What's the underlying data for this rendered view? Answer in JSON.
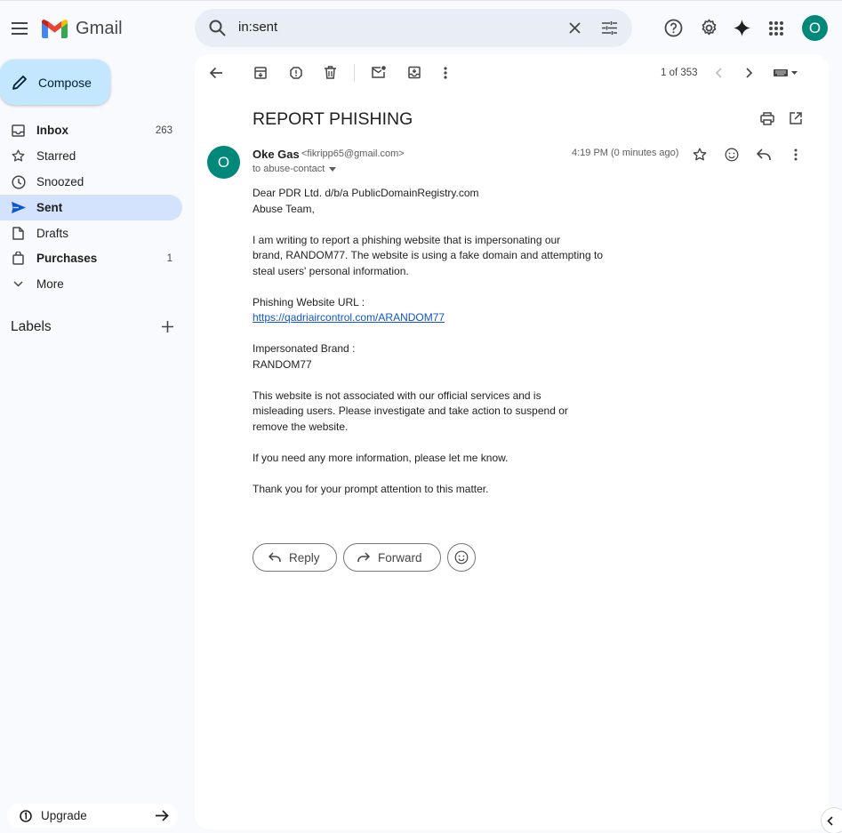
{
  "app": {
    "name": "Gmail"
  },
  "search": {
    "value": "in:sent"
  },
  "account": {
    "initial": "O"
  },
  "sidebar": {
    "compose_label": "Compose",
    "items": [
      {
        "label": "Inbox",
        "count": "263",
        "bold": true,
        "active": false,
        "icon": "inbox-icon"
      },
      {
        "label": "Starred",
        "count": "",
        "bold": false,
        "active": false,
        "icon": "star-icon"
      },
      {
        "label": "Snoozed",
        "count": "",
        "bold": false,
        "active": false,
        "icon": "clock-icon"
      },
      {
        "label": "Sent",
        "count": "",
        "bold": true,
        "active": true,
        "icon": "send-icon"
      },
      {
        "label": "Drafts",
        "count": "",
        "bold": false,
        "active": false,
        "icon": "draft-icon"
      },
      {
        "label": "Purchases",
        "count": "1",
        "bold": true,
        "active": false,
        "icon": "shopping-bag-icon"
      },
      {
        "label": "More",
        "count": "",
        "bold": false,
        "active": false,
        "icon": "chevron-down-icon"
      }
    ],
    "labels_title": "Labels",
    "upgrade_label": "Upgrade"
  },
  "toolbar": {
    "pager": "1 of 353"
  },
  "email": {
    "subject": "REPORT PHISHING",
    "sender_initial": "O",
    "sender_name": "Oke Gas",
    "sender_email": "<fikripp65@gmail.com>",
    "to": "to abuse-contact",
    "time": "4:19 PM (0 minutes ago)",
    "body": {
      "greeting_1": "Dear PDR Ltd. d/b/a PublicDomainRegistry.com",
      "greeting_2": "Abuse Team,",
      "para1_1": "I am writing to report a phishing website that is impersonating our",
      "para1_2": "brand, RANDOM77. The website is using a fake domain and attempting to",
      "para1_3": "steal users' personal information.",
      "url_label": "Phishing Website URL :",
      "url": "https://qadriaircontrol.com/ARANDOM77",
      "brand_label": "Impersonated Brand :",
      "brand": "RANDOM77",
      "para2_1": "This website is not associated with our official services and is",
      "para2_2": "misleading users. Please investigate and take action to suspend or",
      "para2_3": "remove the website.",
      "para3": "If you need any more information, please let me know.",
      "para4": "Thank you for your prompt attention to this matter."
    },
    "reply_label": "Reply",
    "forward_label": "Forward"
  },
  "colors": {
    "accent": "#0b57d0",
    "compose_bg": "#c2e7ff",
    "active_nav": "#d3e3fd",
    "avatar": "#00897b"
  }
}
